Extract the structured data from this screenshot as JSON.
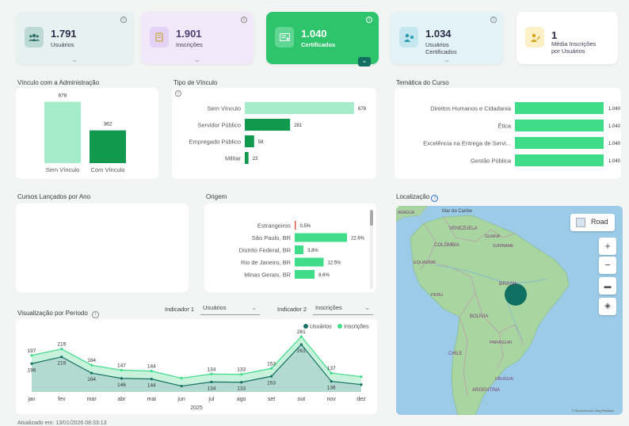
{
  "kpis": [
    {
      "value": "1.791",
      "label": "Usuários",
      "icon": "users-icon"
    },
    {
      "value": "1.901",
      "label": "Inscrições",
      "icon": "form-icon"
    },
    {
      "value": "1.040",
      "label": "Certificados",
      "icon": "certificate-icon"
    },
    {
      "value": "1.034",
      "label1": "Usuários",
      "label2": "Certificados",
      "icon": "user-check-icon"
    },
    {
      "value": "1",
      "label1": "Média Inscrições",
      "label2": "por Usuários",
      "icon": "user-edit-icon"
    }
  ],
  "vinculo_admin": {
    "title": "Vínculo com a Administração",
    "chart_data": {
      "type": "bar",
      "categories": [
        "Sem Vínculo",
        "Com Vínculo"
      ],
      "values": [
        678,
        362
      ],
      "value_labels": [
        "678",
        "362"
      ]
    }
  },
  "tipo_vinculo": {
    "title": "Tipo de Vínculo",
    "chart_data": {
      "type": "bar",
      "orientation": "horizontal",
      "categories": [
        "Sem Vínculo",
        "Servidor Público",
        "Empregado Público",
        "Militar"
      ],
      "values": [
        678,
        281,
        58,
        23
      ],
      "value_labels": [
        "678",
        "281",
        "58",
        "23"
      ]
    }
  },
  "tematica": {
    "title": "Temática do Curso",
    "chart_data": {
      "type": "bar",
      "orientation": "horizontal",
      "categories": [
        "Direitos Humanos e Cidadania",
        "Ética",
        "Excelência na Entrega de Servi...",
        "Gestão Pública"
      ],
      "values": [
        1040,
        1040,
        1040,
        1040
      ],
      "value_labels": [
        "1.040",
        "1.040",
        "1.040",
        "1.040"
      ]
    }
  },
  "cursos_ano": {
    "title": "Cursos Lançados por Ano"
  },
  "origem": {
    "title": "Origem",
    "chart_data": {
      "type": "bar",
      "orientation": "horizontal",
      "categories": [
        "Estrangeiros",
        "São Paulo, BR",
        "Distrito Federal, BR",
        "Rio de Janeiro, BR",
        "Minas Gerais, BR"
      ],
      "values": [
        0.5,
        22.6,
        3.8,
        12.5,
        8.6
      ],
      "value_labels": [
        "0.5%",
        "22.6%",
        "3.8%",
        "12.5%",
        "8.6%"
      ]
    }
  },
  "localizacao": {
    "title": "Localização",
    "road_label": "Road",
    "map_labels": [
      "Mar do Caribe",
      "VENEZUELA",
      "COLÔMBIA",
      "GUIANA",
      "SURINAME",
      "EQUADOR",
      "PERU",
      "BRASIL",
      "BOLÍVIA",
      "PARAGUAI",
      "CHILE",
      "URUGUAI",
      "ARGENTINA",
      "ARAGUA"
    ],
    "attribution": "© Microsoft Azure, Bing Feedback"
  },
  "periodo": {
    "title": "Visualização por Período",
    "ind1_label": "Indicador 1",
    "ind1_value": "Usuários",
    "ind2_label": "Indicador 2",
    "ind2_value": "Inscrições",
    "legend": [
      "Usuários",
      "Inscrições"
    ],
    "year": "2025",
    "chart_data": {
      "type": "area",
      "x": [
        "jan",
        "fev",
        "mar",
        "abr",
        "mai",
        "jun",
        "jul",
        "ago",
        "set",
        "out",
        "nov",
        "dez"
      ],
      "series": [
        {
          "name": "Usuários",
          "values": [
            196,
            219,
            164,
            146,
            144,
            120,
            134,
            133,
            153,
            261,
            136,
            125
          ]
        },
        {
          "name": "Inscrições",
          "values": [
            197,
            219,
            164,
            147,
            144,
            120,
            134,
            133,
            153,
            261,
            137,
            125
          ]
        }
      ],
      "visible_labels_usuarios": [
        "196",
        "219",
        "164",
        "146",
        "144",
        "",
        "134",
        "133",
        "153",
        "261",
        "136",
        ""
      ],
      "visible_labels_inscricoes": [
        "197",
        "219",
        "164",
        "147",
        "144",
        "",
        "134",
        "133",
        "153",
        "261",
        "137",
        ""
      ]
    }
  },
  "footer": {
    "updated": "Atualizado em: 13/01/2026 08:33:13"
  },
  "colors": {
    "dark_green": "#119a4e",
    "mid_green": "#3fdd8a",
    "light_green": "#a5edca",
    "teal": "#137062"
  }
}
